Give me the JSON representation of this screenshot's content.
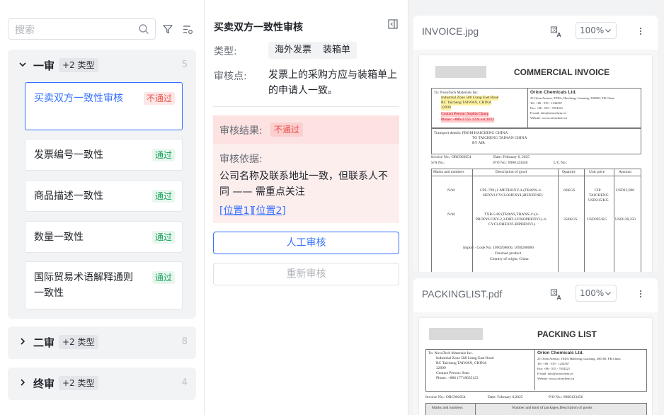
{
  "left": {
    "search_placeholder": "搜索",
    "groups": [
      {
        "title": "一审",
        "tag": "+2 类型",
        "count": "5"
      },
      {
        "title": "二审",
        "tag": "+2 类型",
        "count": "8"
      },
      {
        "title": "终审",
        "tag": "+2 类型",
        "count": "4"
      }
    ],
    "items": [
      {
        "label": "买卖双方一致性审核",
        "status": "不通过"
      },
      {
        "label": "发票编号一致性",
        "status": "通过"
      },
      {
        "label": "商品描述一致性",
        "status": "通过"
      },
      {
        "label": "数量一致性",
        "status": "通过"
      },
      {
        "label": "国际贸易术语解释通则一致性",
        "status": "通过"
      }
    ]
  },
  "middle": {
    "title": "买卖双方一致性审核",
    "type_label": "类型:",
    "types": [
      "海外发票",
      "装箱单"
    ],
    "point_label": "审核点:",
    "point_text": "发票上的采购方应与装箱单上的申请人一致。",
    "result_label": "审核结果:",
    "result_value": "不通过",
    "basis_label": "审核依据:",
    "basis_text": "公司名称及联系地址一致，但联系人不同 —— 需重点关注",
    "link1": "[位置1]",
    "link2": "[位置2]",
    "manual_btn": "人工审核",
    "recheck_btn": "重新审核"
  },
  "docs": [
    {
      "name": "INVOICE.jpg",
      "zoom": "100%",
      "page_title": "COMMERCIAL INVOICE"
    },
    {
      "name": "PACKINGLIST.pdf",
      "zoom": "100%",
      "page_title": "PACKING LIST"
    }
  ],
  "invoice": {
    "to_lines": [
      "To: NovaTech Materials Inc.",
      "Industrial Zone 588 Liang East Road",
      "RC   Taicheng TAIWAN, CHINA",
      "32999"
    ],
    "contact_lines": [
      "Contact Person: Sophia Chang",
      "Phone: +886-3 555 1234 ext.1022"
    ],
    "from_lines": [
      "Orion Chemicals Ltd.",
      "25 Orion Avenue, TEDA, Haicheng, Liaoning, 300500, P.R.China",
      "Tel: +86 - 535 - 1234567",
      "Fax: +86 - 535 - 7654321",
      "E-mail: info@orionchem.cn",
      "Website: www.orionchem.cn"
    ],
    "transport": [
      "Transport details: FROM HAICHENG CHINA",
      "TO TAICHENG TAIWAN CHINA",
      "BY AIR"
    ],
    "invoice_no": "Invoice No.: ORC902654",
    "date": "Date: February 6, 2025",
    "sn": "S/N No.:",
    "po": "P/O No.: 8900123456",
    "lc": "L/C No.:",
    "cols": [
      "Marks and numbers",
      "Description of good",
      "Quantity",
      "Unit price",
      "Amount"
    ],
    "rows": [
      {
        "mark": "N/M",
        "desc": [
          "CPL-709 (1-METHOXY-4-(TRANS-4-",
          "HEXYLCYCLOHEXYL)BENZENE)"
        ],
        "qty": "60KGS",
        "unit": [
          "CIP",
          "TAICHENG",
          "USD215/KG"
        ],
        "amount": "USD12,900"
      },
      {
        "mark": "N/M",
        "desc": [
          "TXR-5-88 (TRANS,TRANS-4'-(4-",
          "PROPYLOXY-2,3-DIFLUOROPHENYL)-4-",
          "CYCLOHEXYLBIPHENYL)"
        ],
        "qty": "350KGS",
        "unit": [
          "USD395/KG"
        ],
        "amount": "USD138,250"
      }
    ],
    "footer": [
      "Import · Code No: 1090208000, 1090208080",
      "Finished product",
      "Country of origin: China"
    ]
  },
  "packing": {
    "to_lines": [
      "To: NovaTech Materials Inc.",
      "Industrial Zone 588 Liang East Road",
      "RC   Taicheng TAIWAN, CHINA",
      "32999",
      "Contact Person: Sean",
      "Phone: +886 17718635123"
    ],
    "from_lines": [
      "Orion Chemicals Ltd.",
      "25 Orion Avenue, TEDA Haicheng, Liaoning, 300100, P.R.China",
      "Tel: +86 - 535 - 1234567",
      "Fax: +86 - 535 - 7654321",
      "E-mail: info@orionchem.cn",
      "Website: www.orionchem.cn"
    ],
    "invoice_no": "Invoice No.: ORC902654",
    "date": "Date: February 6,2025",
    "po": "P/O No.: 8900123456",
    "cols": [
      "Marks and numbers",
      "Number and kind of packages,Description of goods"
    ]
  }
}
